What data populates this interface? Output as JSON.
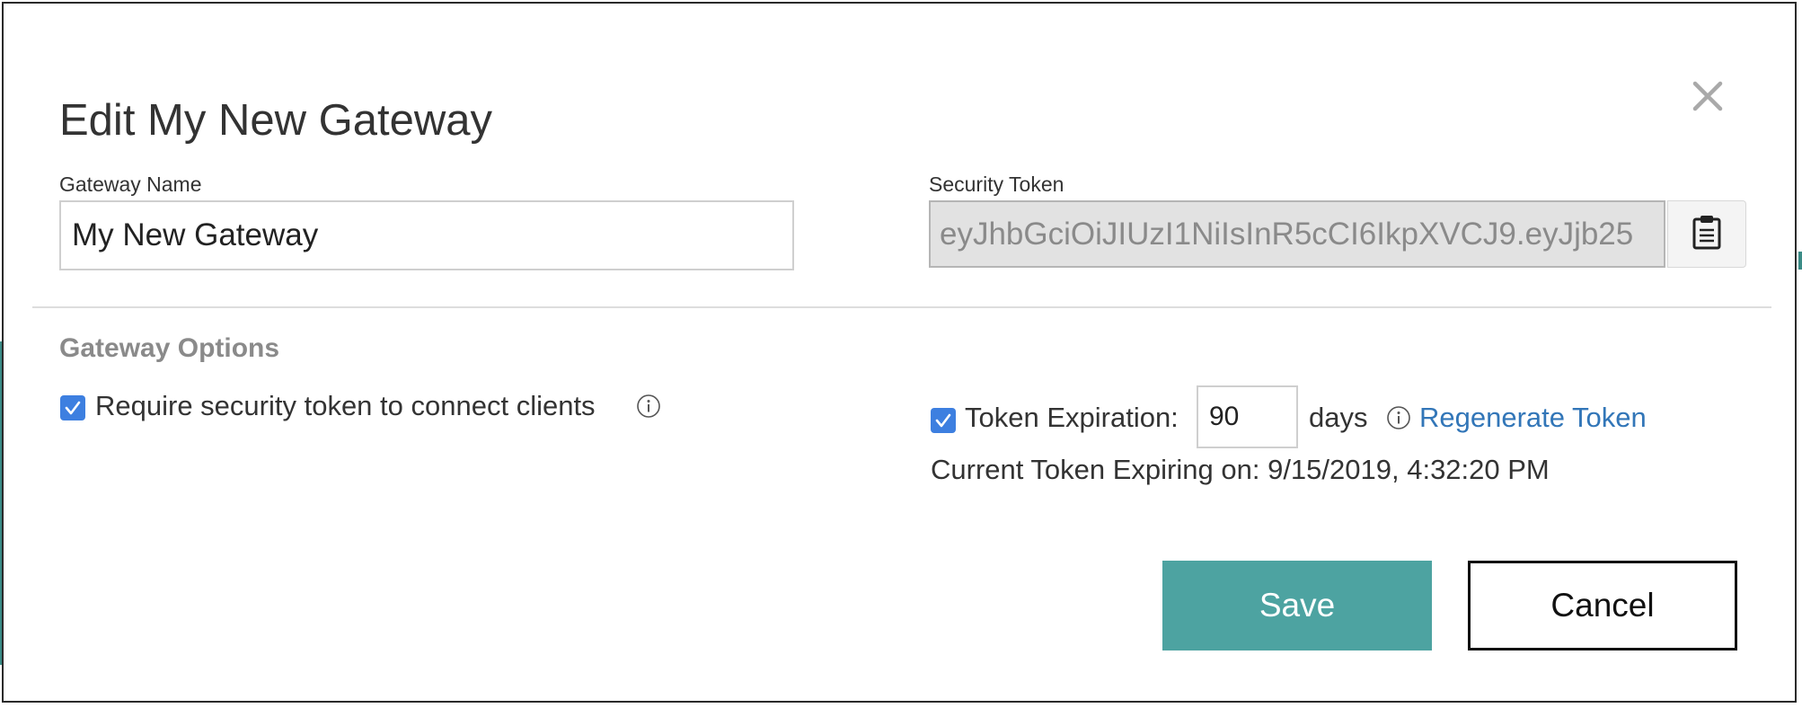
{
  "dialog": {
    "title": "Edit My New Gateway",
    "close_icon": "close-icon"
  },
  "gateway_name": {
    "label": "Gateway Name",
    "value": "My New Gateway"
  },
  "security_token": {
    "label": "Security Token",
    "value": "eyJhbGciOiJIUzI1NiIsInR5cCI6IkpXVCJ9.eyJjb25",
    "copy_icon": "clipboard-icon"
  },
  "options": {
    "section_title": "Gateway Options",
    "require_token": {
      "checked": true,
      "label": "Require security token to connect clients",
      "info_icon": "info-icon"
    },
    "token_expiration": {
      "checked": true,
      "label": "Token Expiration:",
      "days_value": "90",
      "days_label": "days",
      "info_icon": "info-icon",
      "regenerate_label": "Regenerate Token"
    },
    "current_expiry": "Current Token Expiring on: 9/15/2019, 4:32:20 PM"
  },
  "actions": {
    "save_label": "Save",
    "cancel_label": "Cancel"
  },
  "colors": {
    "primary": "#4da3a1",
    "checkbox": "#3d7fe0",
    "link": "#3276b8"
  }
}
